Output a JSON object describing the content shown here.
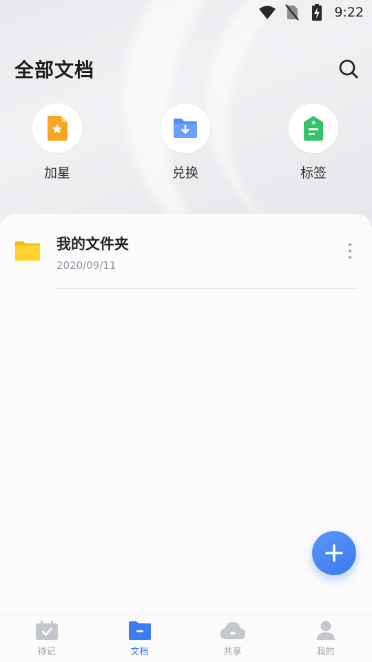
{
  "status_bar": {
    "time": "9:22",
    "icons": [
      "wifi-icon",
      "no-sim-icon",
      "battery-charging-icon"
    ]
  },
  "header": {
    "title": "全部文档",
    "search_icon": "search-icon"
  },
  "shortcuts": [
    {
      "label": "加星",
      "icon": "star-document-icon",
      "color": "#f6a623"
    },
    {
      "label": "兑换",
      "icon": "folder-download-icon",
      "color": "#4f8cf5"
    },
    {
      "label": "标签",
      "icon": "tag-icon",
      "color": "#35c46a"
    }
  ],
  "files": [
    {
      "name": "我的文件夹",
      "date": "2020/09/11",
      "icon": "folder-icon",
      "more_icon": "more-vertical-icon"
    }
  ],
  "fab": {
    "icon": "plus-icon",
    "color": "#3c78ee"
  },
  "bottom_nav": [
    {
      "label": "待记",
      "icon": "calendar-check-icon",
      "active": false
    },
    {
      "label": "文档",
      "icon": "document-folder-icon",
      "active": true
    },
    {
      "label": "共享",
      "icon": "cloud-icon",
      "active": false
    },
    {
      "label": "我的",
      "icon": "user-icon",
      "active": false
    }
  ],
  "colors": {
    "accent": "#3b7cf0",
    "inactive": "#c3c6cc",
    "folder": "#ffc928"
  }
}
